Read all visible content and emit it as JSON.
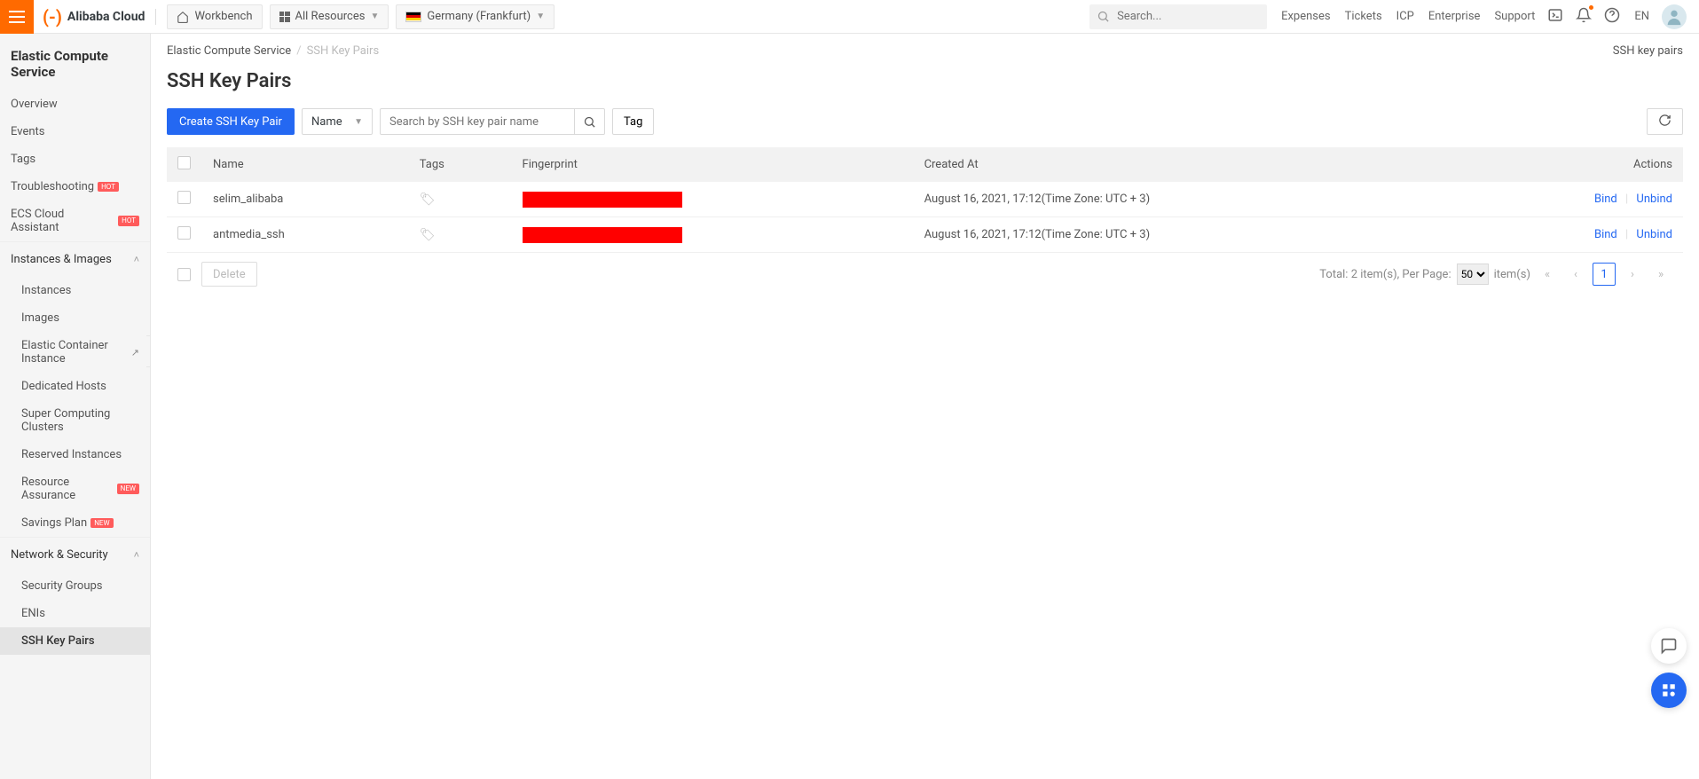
{
  "header": {
    "brand": "Alibaba Cloud",
    "workbench": "Workbench",
    "all_resources": "All Resources",
    "region": "Germany (Frankfurt)",
    "search_placeholder": "Search...",
    "links": {
      "expenses": "Expenses",
      "tickets": "Tickets",
      "icp": "ICP",
      "enterprise": "Enterprise",
      "support": "Support"
    },
    "lang": "EN"
  },
  "sidebar": {
    "title": "Elastic Compute Service",
    "items": {
      "overview": "Overview",
      "events": "Events",
      "tags": "Tags",
      "troubleshooting": "Troubleshooting",
      "troubleshooting_badge": "HOT",
      "cloud_assistant": "ECS Cloud Assistant",
      "cloud_assistant_badge": "HOT"
    },
    "group_instances": "Instances & Images",
    "instances": "Instances",
    "images": "Images",
    "eci": "Elastic Container Instance",
    "dedicated_hosts": "Dedicated Hosts",
    "super_clusters": "Super Computing Clusters",
    "reserved": "Reserved Instances",
    "resource_assurance": "Resource Assurance",
    "resource_assurance_badge": "NEW",
    "savings": "Savings Plan",
    "savings_badge": "NEW",
    "group_network": "Network & Security",
    "security_groups": "Security Groups",
    "enis": "ENIs",
    "ssh_key_pairs": "SSH Key Pairs"
  },
  "breadcrumb": {
    "root": "Elastic Compute Service",
    "current": "SSH Key Pairs",
    "right": "SSH key pairs"
  },
  "page": {
    "title": "SSH Key Pairs"
  },
  "toolbar": {
    "create": "Create SSH Key Pair",
    "filter_by": "Name",
    "search_placeholder": "Search by SSH key pair name",
    "tag": "Tag"
  },
  "table": {
    "cols": {
      "name": "Name",
      "tags": "Tags",
      "fingerprint": "Fingerprint",
      "created": "Created At",
      "actions": "Actions"
    },
    "rows": [
      {
        "name": "selim_alibaba",
        "created": "August 16, 2021, 17:12(Time Zone: UTC + 3)"
      },
      {
        "name": "antmedia_ssh",
        "created": "August 16, 2021, 17:12(Time Zone: UTC + 3)"
      }
    ],
    "actions": {
      "bind": "Bind",
      "unbind": "Unbind"
    }
  },
  "bulk": {
    "delete": "Delete"
  },
  "pager": {
    "total_prefix": "Total: ",
    "total_count": "2",
    "total_mid": " item(s), Per Page: ",
    "per_page": "50",
    "items_suffix": " item(s)",
    "page": "1"
  }
}
